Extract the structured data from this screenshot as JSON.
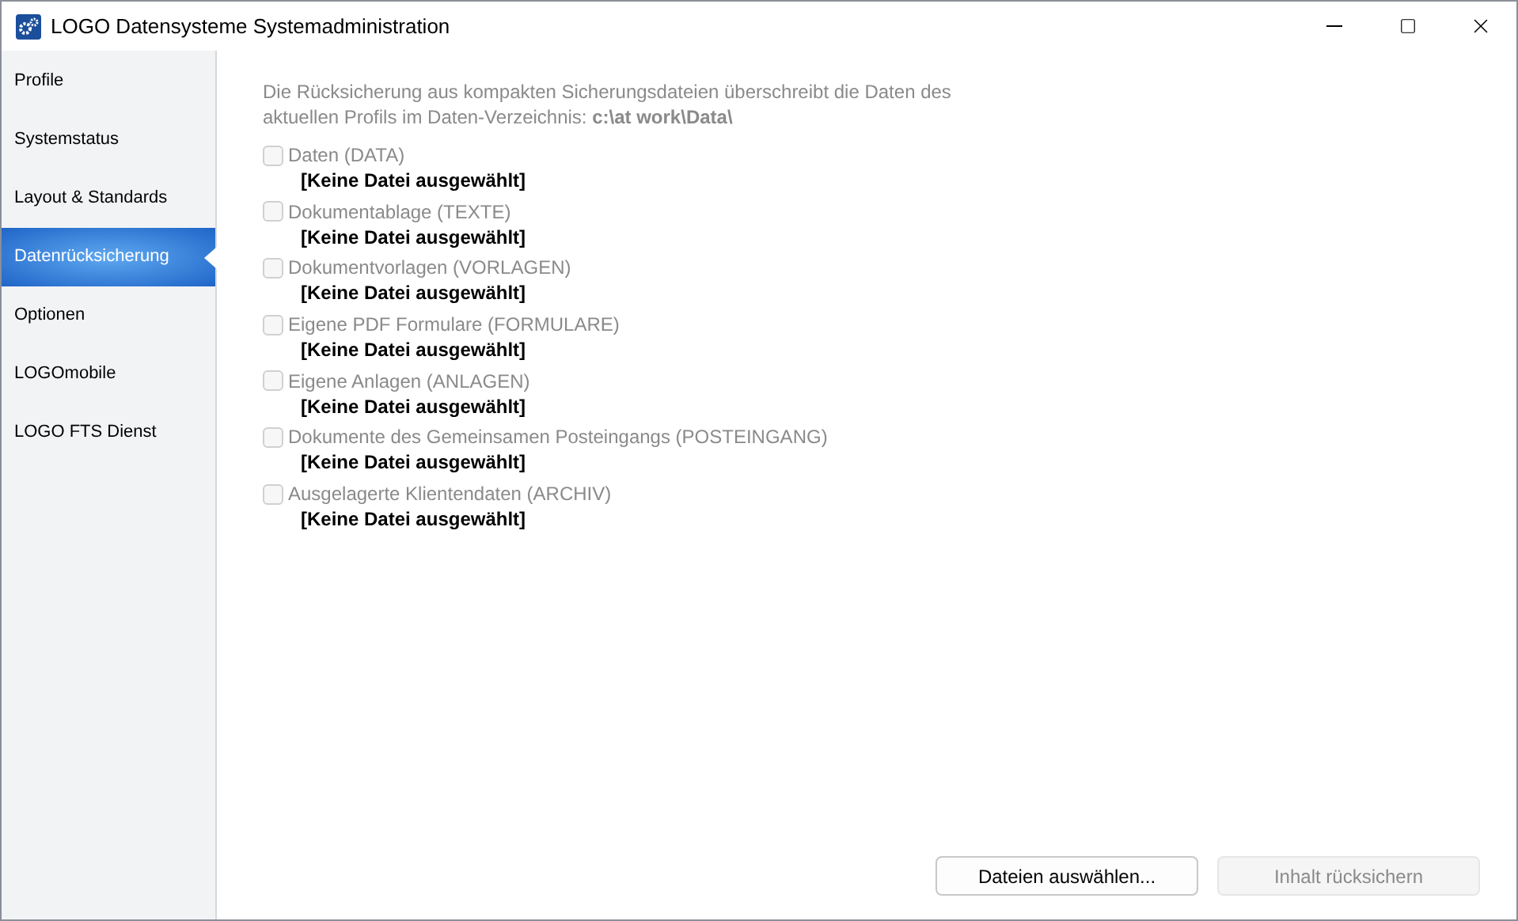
{
  "window": {
    "title": "LOGO Datensysteme Systemadministration"
  },
  "sidebar": {
    "items": [
      {
        "label": "Profile",
        "selected": false
      },
      {
        "label": "Systemstatus",
        "selected": false
      },
      {
        "label": "Layout & Standards",
        "selected": false
      },
      {
        "label": "Datenrücksicherung",
        "selected": true
      },
      {
        "label": "Optionen",
        "selected": false
      },
      {
        "label": "LOGOmobile",
        "selected": false
      },
      {
        "label": "LOGO FTS Dienst",
        "selected": false
      }
    ]
  },
  "description": "Die Rücksicherung aus kompakten  Sicherungsdateien überschreibt die Daten des aktuellen Profils im Daten-Verzeichnis:  **c:\\at work\\Data\\**",
  "options": [
    {
      "label": "Daten (DATA)",
      "file": "[Keine Datei ausgewählt]",
      "checked": false,
      "disabled": true
    },
    {
      "label": "Dokumentablage (TEXTE)",
      "file": "[Keine Datei ausgewählt]",
      "checked": false,
      "disabled": true
    },
    {
      "label": "Dokumentvorlagen (VORLAGEN)",
      "file": "[Keine Datei ausgewählt]",
      "checked": false,
      "disabled": true
    },
    {
      "label": "Eigene PDF Formulare (FORMULARE)",
      "file": "[Keine Datei ausgewählt]",
      "checked": false,
      "disabled": true
    },
    {
      "label": "Eigene Anlagen (ANLAGEN)",
      "file": "[Keine Datei ausgewählt]",
      "checked": false,
      "disabled": true
    },
    {
      "label": "Dokumente des Gemeinsamen Posteingangs (POSTEINGANG)",
      "file": "[Keine Datei ausgewählt]",
      "checked": false,
      "disabled": true
    },
    {
      "label": "Ausgelagerte Klientendaten (ARCHIV)",
      "file": "[Keine Datei ausgewählt]",
      "checked": false,
      "disabled": true
    }
  ],
  "buttons": [
    {
      "label": "Dateien auswählen...",
      "disabled": false
    },
    {
      "label": "Inhalt rücksichern",
      "disabled": true
    }
  ]
}
